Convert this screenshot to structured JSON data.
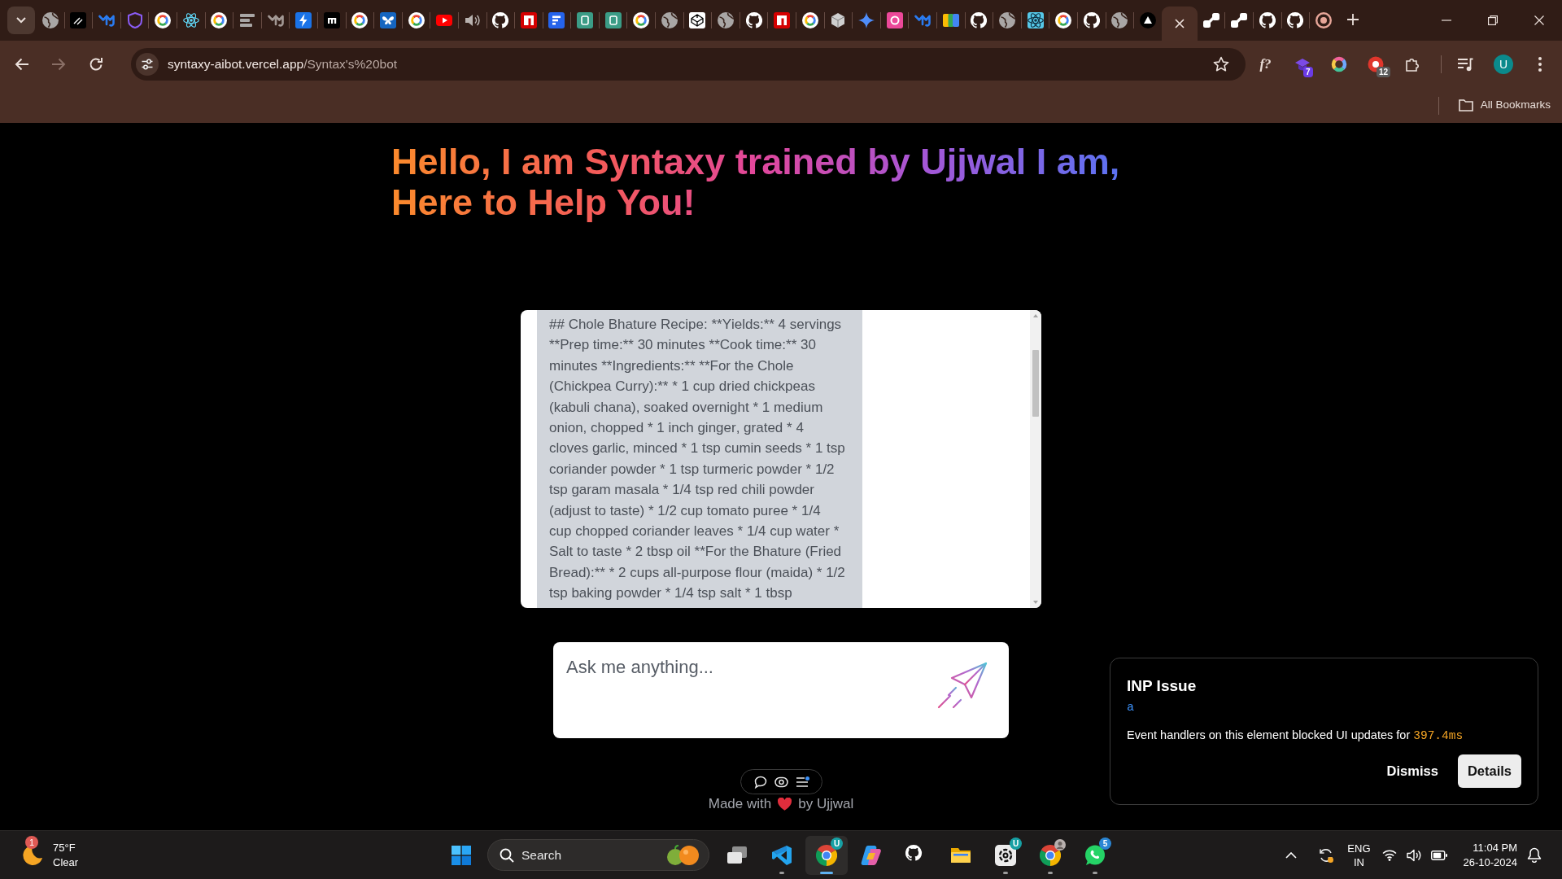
{
  "browser": {
    "tabs": [
      {
        "kind": "globe",
        "selected": false
      },
      {
        "kind": "slash",
        "selected": false
      },
      {
        "kind": "mj",
        "selected": false
      },
      {
        "kind": "shield",
        "selected": false
      },
      {
        "kind": "google",
        "selected": false
      },
      {
        "kind": "react",
        "selected": false
      },
      {
        "kind": "google",
        "selected": false
      },
      {
        "kind": "lines",
        "selected": false
      },
      {
        "kind": "mjgray",
        "selected": false
      },
      {
        "kind": "bolt",
        "selected": false
      },
      {
        "kind": "mtile",
        "selected": false
      },
      {
        "kind": "google",
        "selected": false
      },
      {
        "kind": "butterfly",
        "selected": false
      },
      {
        "kind": "google",
        "selected": false
      },
      {
        "kind": "youtube",
        "selected": false
      },
      {
        "kind": "speaker",
        "selected": false
      },
      {
        "kind": "github",
        "selected": false
      },
      {
        "kind": "ntile",
        "selected": false
      },
      {
        "kind": "ftile",
        "selected": false
      },
      {
        "kind": "ptile",
        "selected": false
      },
      {
        "kind": "ptile",
        "selected": false
      },
      {
        "kind": "google",
        "selected": false
      },
      {
        "kind": "globe",
        "selected": false
      },
      {
        "kind": "codepen",
        "selected": false
      },
      {
        "kind": "globe",
        "selected": false
      },
      {
        "kind": "github",
        "selected": false
      },
      {
        "kind": "ntile",
        "selected": false
      },
      {
        "kind": "google",
        "selected": false
      },
      {
        "kind": "cube",
        "selected": false
      },
      {
        "kind": "sparkle",
        "selected": false
      },
      {
        "kind": "stile",
        "selected": false
      },
      {
        "kind": "mj",
        "selected": false
      },
      {
        "kind": "ab",
        "selected": false
      },
      {
        "kind": "github",
        "selected": false
      },
      {
        "kind": "globe",
        "selected": false
      },
      {
        "kind": "reacttile",
        "selected": false
      },
      {
        "kind": "google",
        "selected": false
      },
      {
        "kind": "github",
        "selected": false
      },
      {
        "kind": "globe",
        "selected": false
      },
      {
        "kind": "triangle",
        "selected": false
      },
      {
        "selected": true
      },
      {
        "kind": "link",
        "selected": false
      },
      {
        "kind": "link",
        "selected": false
      },
      {
        "kind": "github",
        "selected": false
      },
      {
        "kind": "github",
        "selected": false
      },
      {
        "kind": "chrome",
        "selected": false
      }
    ],
    "toolbar": {
      "nav_buttons": [
        {
          "kind": "back",
          "disabled": false
        },
        {
          "kind": "forward",
          "disabled": true
        },
        {
          "kind": "reload",
          "disabled": false
        }
      ],
      "url": {
        "host": "syntaxy-aibot.vercel.app",
        "path": "/Syntax's%20bot"
      },
      "extensions": [
        {
          "kind": "formula",
          "label": "f?"
        },
        {
          "kind": "cap",
          "badge": "7"
        },
        {
          "kind": "colorring"
        },
        {
          "kind": "record",
          "badge": "12"
        },
        {
          "kind": "puzzle"
        }
      ],
      "profile": {
        "initial": "U"
      }
    },
    "bookmarks_bar": {
      "label": "All Bookmarks"
    }
  },
  "page": {
    "heading": "Hello, I am Syntaxy trained by Ujjwal I am, Here to Help You!",
    "chat": {
      "messages": [
        {
          "text": "## Chole Bhature Recipe: **Yields:** 4 servings **Prep time:** 30 minutes **Cook time:** 30 minutes **Ingredients:** **For the Chole (Chickpea Curry):** * 1 cup dried chickpeas (kabuli chana), soaked overnight * 1 medium onion, chopped * 1 inch ginger, grated * 4 cloves garlic, minced * 1 tsp cumin seeds * 1 tsp coriander powder * 1 tsp turmeric powder * 1/2 tsp garam masala * 1/4 tsp red chili powder (adjust to taste) * 1/2 cup tomato puree * 1/4 cup chopped coriander leaves * 1/4 cup water * Salt to taste * 2 tbsp oil **For the Bhature (Fried Bread):** * 2 cups all-purpose flour (maida) * 1/2 tsp baking powder * 1/4 tsp salt * 1 tbsp"
        }
      ]
    },
    "prompt": {
      "placeholder": "Ask me anything..."
    },
    "footer": {
      "prefix": "Made with",
      "suffix": "by Ujjwal"
    }
  },
  "dev_popup": {
    "title": "INP Issue",
    "element": "a",
    "message": "Event handlers on this element blocked UI updates for",
    "duration": "397.4ms",
    "buttons": [
      {
        "label": "Dismiss",
        "kind": "text"
      },
      {
        "label": "Details",
        "kind": "filled"
      }
    ]
  },
  "taskbar": {
    "weather": {
      "badge": "1",
      "temperature": "75°F",
      "condition": "Clear"
    },
    "search": {
      "placeholder": "Search"
    },
    "apps": [
      {
        "kind": "taskview",
        "running": false,
        "selected": false
      },
      {
        "kind": "vscode",
        "running": true,
        "selected": false
      },
      {
        "kind": "chrome",
        "running": true,
        "selected": true,
        "badge": "U"
      },
      {
        "kind": "copilot",
        "running": false,
        "selected": false
      },
      {
        "kind": "github",
        "running": false,
        "selected": false
      },
      {
        "kind": "explorer",
        "running": false,
        "selected": false
      },
      {
        "kind": "chatgpt",
        "running": true,
        "selected": false,
        "badge": "U"
      },
      {
        "kind": "chromeprofile",
        "running": true,
        "selected": false
      },
      {
        "kind": "whatsapp",
        "running": true,
        "selected": false,
        "badge": "5"
      }
    ],
    "tray": {
      "language": "ENG",
      "region": "IN",
      "time": "11:04 PM",
      "date": "26-10-2024"
    }
  }
}
